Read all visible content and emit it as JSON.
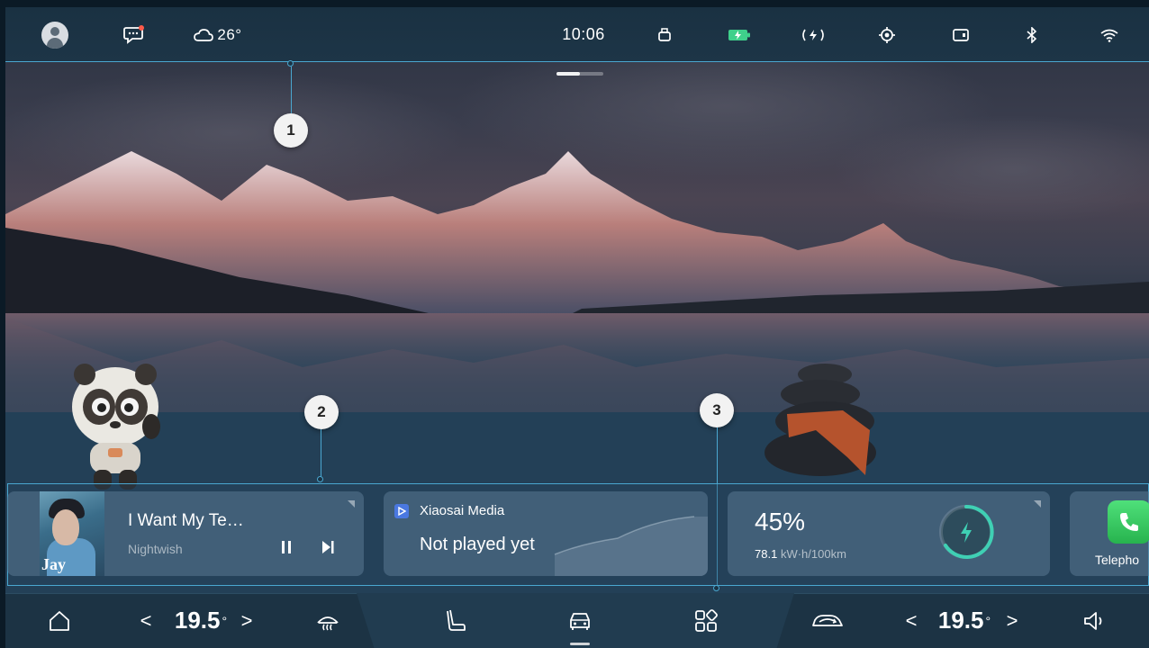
{
  "status_bar": {
    "weather": "26°",
    "time": "10:06",
    "icons": [
      "avatar",
      "message-icon",
      "cloud-icon",
      "usb-icon",
      "battery-icon",
      "wireless-charging-icon",
      "location-icon",
      "dashcam-icon",
      "bluetooth-icon",
      "wifi-icon"
    ]
  },
  "callouts": [
    "1",
    "2",
    "3"
  ],
  "cards": {
    "music": {
      "title": "I Want My Te…",
      "artist": "Nightwish",
      "album_text": "Jay"
    },
    "media": {
      "app_name": "Xiaosai Media",
      "status": "Not played yet"
    },
    "energy": {
      "percent": "45%",
      "consumption_value": "78.1",
      "consumption_unit": "kW·h/100km"
    },
    "phone": {
      "label": "Telepho"
    }
  },
  "dock": {
    "left_temp": "19.5",
    "right_temp": "19.5",
    "degree": "°",
    "left_arrow": "<",
    "right_arrow": ">"
  },
  "colors": {
    "callout_line": "#4aa7d0",
    "phone_green": "#3ccf63",
    "charge_teal": "#3fd0b4"
  }
}
